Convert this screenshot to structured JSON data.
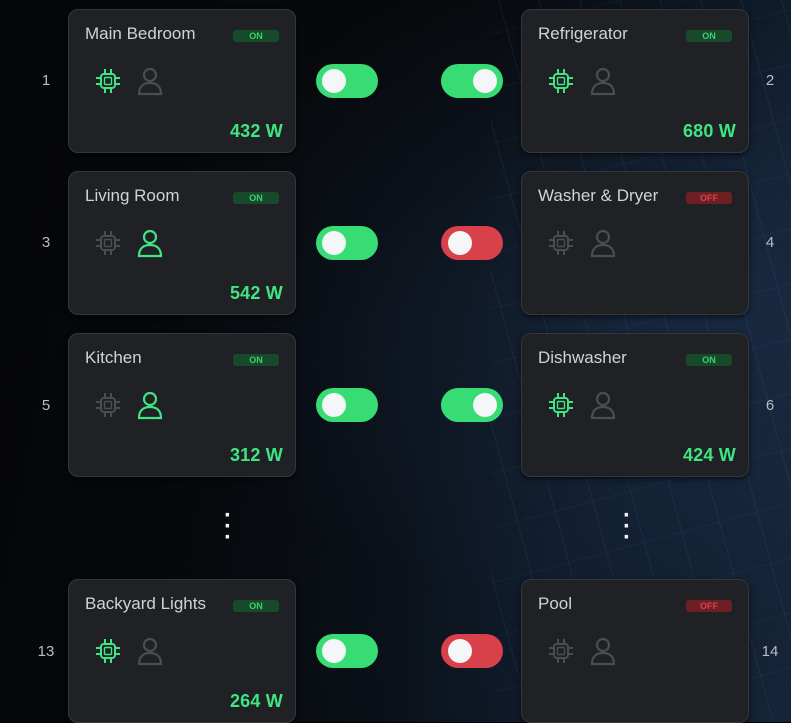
{
  "devices": [
    {
      "index": "1",
      "name": "Main Bedroom",
      "status": "ON",
      "power": "432 W",
      "chip_active": true,
      "person_active": false,
      "toggle": "on"
    },
    {
      "index": "2",
      "name": "Refrigerator",
      "status": "ON",
      "power": "680 W",
      "chip_active": true,
      "person_active": false,
      "toggle": "on"
    },
    {
      "index": "3",
      "name": "Living Room",
      "status": "ON",
      "power": "542 W",
      "chip_active": false,
      "person_active": true,
      "toggle": "on"
    },
    {
      "index": "4",
      "name": "Washer & Dryer",
      "status": "OFF",
      "power": "",
      "chip_active": false,
      "person_active": false,
      "toggle": "off"
    },
    {
      "index": "5",
      "name": "Kitchen",
      "status": "ON",
      "power": "312 W",
      "chip_active": false,
      "person_active": true,
      "toggle": "on"
    },
    {
      "index": "6",
      "name": "Dishwasher",
      "status": "ON",
      "power": "424 W",
      "chip_active": true,
      "person_active": false,
      "toggle": "on"
    },
    {
      "index": "13",
      "name": "Backyard Lights",
      "status": "ON",
      "power": "264 W",
      "chip_active": true,
      "person_active": false,
      "toggle": "on"
    },
    {
      "index": "14",
      "name": "Pool",
      "status": "OFF",
      "power": "",
      "chip_active": false,
      "person_active": false,
      "toggle": "off"
    }
  ],
  "colors": {
    "active_green": "#3ee582",
    "inactive_gray": "#4a4d52",
    "toggle_on": "#37dd74",
    "toggle_off": "#d8414a"
  },
  "icons": {
    "chip": "chip-icon",
    "person": "person-icon",
    "more": "vertical-ellipsis-icon"
  }
}
